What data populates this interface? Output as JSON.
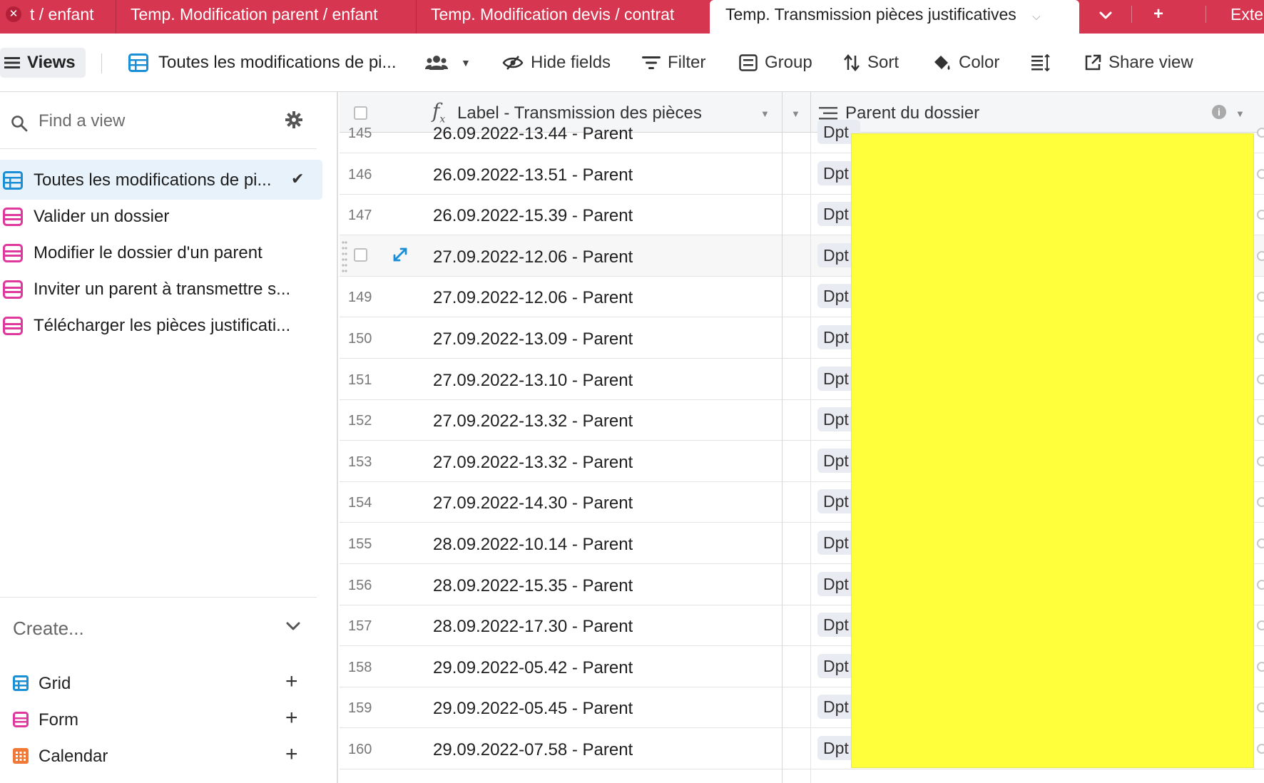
{
  "tabs": [
    {
      "label": "t / enfant"
    },
    {
      "label": "Temp. Modification parent / enfant"
    },
    {
      "label": "Temp. Modification devis / contrat"
    },
    {
      "label": "Temp. Transmission pièces justificatives"
    },
    {
      "label": "Exte"
    }
  ],
  "toolbar": {
    "views_label": "Views",
    "current_view": "Toutes les modifications de pi...",
    "hide_fields": "Hide fields",
    "filter": "Filter",
    "group": "Group",
    "sort": "Sort",
    "color": "Color",
    "share_view": "Share view"
  },
  "sidebar": {
    "search_placeholder": "Find a view",
    "views": [
      {
        "label": "Toutes les modifications de pi...",
        "type": "grid",
        "selected": true
      },
      {
        "label": "Valider un dossier",
        "type": "form"
      },
      {
        "label": "Modifier le dossier d'un parent",
        "type": "form"
      },
      {
        "label": "Inviter un parent à transmettre s...",
        "type": "form"
      },
      {
        "label": "Télécharger les pièces justificati...",
        "type": "form"
      }
    ],
    "create_label": "Create...",
    "create_items": [
      {
        "label": "Grid",
        "icon": "grid-icon"
      },
      {
        "label": "Form",
        "icon": "form-icon"
      },
      {
        "label": "Calendar",
        "icon": "calendar-icon"
      }
    ]
  },
  "grid": {
    "col1_header": "Label - Transmission des pièces",
    "col2_header": "Parent du dossier",
    "chip_text": "Dpt",
    "rows": [
      {
        "num": "145",
        "label": "26.09.2022-13.44 - Parent"
      },
      {
        "num": "146",
        "label": "26.09.2022-13.51 - Parent"
      },
      {
        "num": "147",
        "label": "26.09.2022-15.39 - Parent"
      },
      {
        "num": "",
        "label": "27.09.2022-12.06 - Parent"
      },
      {
        "num": "149",
        "label": "27.09.2022-12.06 - Parent"
      },
      {
        "num": "150",
        "label": "27.09.2022-13.09 - Parent"
      },
      {
        "num": "151",
        "label": "27.09.2022-13.10 - Parent"
      },
      {
        "num": "152",
        "label": "27.09.2022-13.32 - Parent"
      },
      {
        "num": "153",
        "label": "27.09.2022-13.32 - Parent"
      },
      {
        "num": "154",
        "label": "27.09.2022-14.30 - Parent"
      },
      {
        "num": "155",
        "label": "28.09.2022-10.14 - Parent"
      },
      {
        "num": "156",
        "label": "28.09.2022-15.35 - Parent"
      },
      {
        "num": "157",
        "label": "28.09.2022-17.30 - Parent"
      },
      {
        "num": "158",
        "label": "29.09.2022-05.42 - Parent"
      },
      {
        "num": "159",
        "label": "29.09.2022-05.45 - Parent"
      },
      {
        "num": "160",
        "label": "29.09.2022-07.58 - Parent"
      }
    ]
  },
  "colors": {
    "tab_bar": "#d6364f",
    "grid_icon": "#1a8fd6",
    "form_icon": "#e0399e",
    "calendar_icon": "#f27935",
    "redaction": "#ffff3b"
  }
}
